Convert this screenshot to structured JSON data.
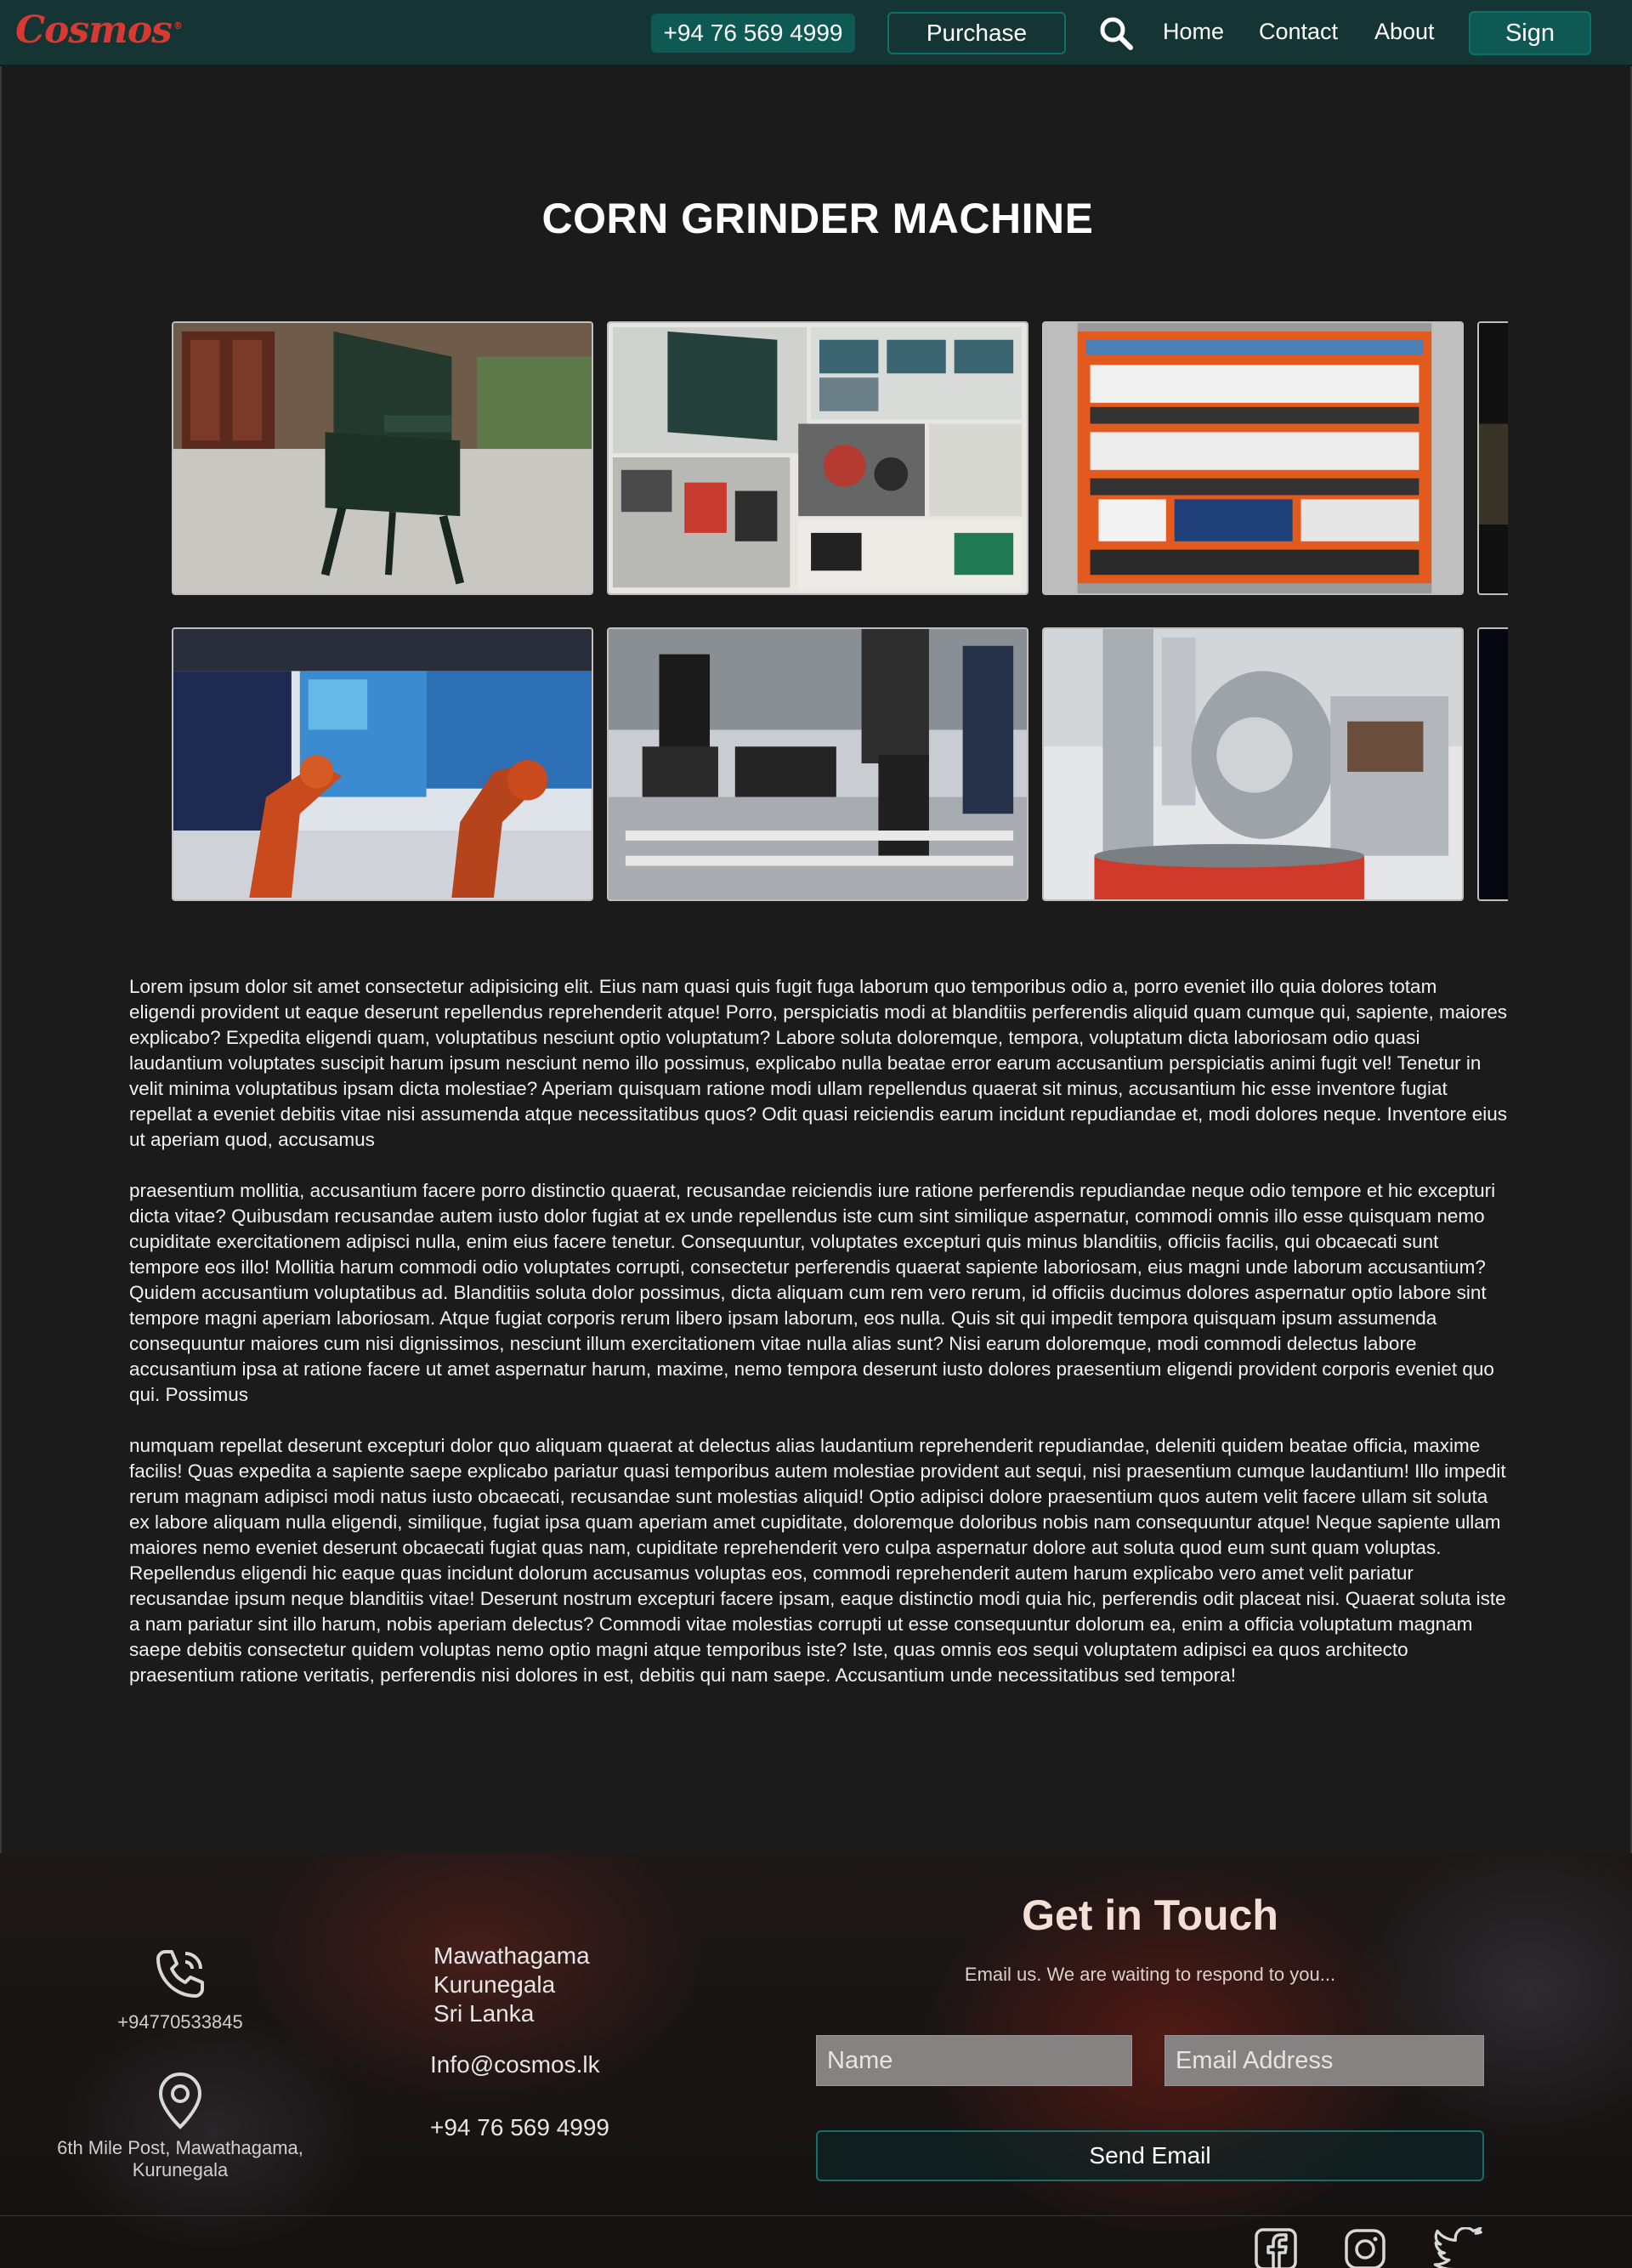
{
  "colors": {
    "page_bg": "#1b1b1b",
    "navbar_bg": "#143533",
    "accent_teal": "#0f5954",
    "logo_red": "#d83a33"
  },
  "navbar": {
    "logo": "Cosmos",
    "logo_mark": "®",
    "phone": "+94 76 569 4999",
    "purchase_label": "Purchase",
    "search_icon": "search-icon",
    "links": [
      "Home",
      "Contact",
      "About"
    ],
    "sign_label": "Sign"
  },
  "main": {
    "title": "CORN GRINDER MACHINE",
    "gallery": {
      "row1": [
        "corn-grinder-machine-photo",
        "machine-parts-collage-photo",
        "electrical-control-panel-photo",
        "partial-next-photo"
      ],
      "row2": [
        "orange-robot-arms-photo",
        "industrial-robotic-arms-photo",
        "coffee-roaster-machine-photo",
        "partial-next-photo"
      ]
    },
    "paragraphs": [
      "Lorem ipsum dolor sit amet consectetur adipisicing elit. Eius nam quasi quis fugit fuga laborum quo temporibus odio a, porro eveniet illo quia dolores totam eligendi provident ut eaque deserunt repellendus reprehenderit atque! Porro, perspiciatis modi at blanditiis perferendis aliquid quam cumque qui, sapiente, maiores explicabo? Expedita eligendi quam, voluptatibus nesciunt optio voluptatum? Labore soluta doloremque, tempora, voluptatum dicta laboriosam odio quasi laudantium voluptates suscipit harum ipsum nesciunt nemo illo possimus, explicabo nulla beatae error earum accusantium perspiciatis animi fugit vel! Tenetur in velit minima voluptatibus ipsam dicta molestiae? Aperiam quisquam ratione modi ullam repellendus quaerat sit minus, accusantium hic esse inventore fugiat repellat a eveniet debitis vitae nisi assumenda atque necessitatibus quos? Odit quasi reiciendis earum incidunt repudiandae et, modi dolores neque. Inventore eius ut aperiam quod, accusamus",
      "praesentium mollitia, accusantium facere porro distinctio quaerat, recusandae reiciendis iure ratione perferendis repudiandae neque odio tempore et hic excepturi dicta vitae? Quibusdam recusandae autem iusto dolor fugiat at ex unde repellendus iste cum sint similique aspernatur, commodi omnis illo esse quisquam nemo cupiditate exercitationem adipisci nulla, enim eius facere tenetur. Consequuntur, voluptates excepturi quis minus blanditiis, officiis facilis, qui obcaecati sunt tempore eos illo! Mollitia harum commodi odio voluptates corrupti, consectetur perferendis quaerat sapiente laboriosam, eius magni unde laborum accusantium? Quidem accusantium voluptatibus ad. Blanditiis soluta dolor possimus, dicta aliquam cum rem vero rerum, id officiis ducimus dolores aspernatur optio labore sint tempore magni aperiam laboriosam. Atque fugiat corporis rerum libero ipsam laborum, eos nulla. Quis sit qui impedit tempora quisquam ipsum assumenda consequuntur maiores cum nisi dignissimos, nesciunt illum exercitationem vitae nulla alias sunt? Nisi earum doloremque, modi commodi delectus labore accusantium ipsa at ratione facere ut amet aspernatur harum, maxime, nemo tempora deserunt iusto dolores praesentium eligendi provident corporis eveniet quo qui. Possimus",
      "numquam repellat deserunt excepturi dolor quo aliquam quaerat at delectus alias laudantium reprehenderit repudiandae, deleniti quidem beatae officia, maxime facilis! Quas expedita a sapiente saepe explicabo pariatur quasi temporibus autem molestiae provident aut sequi, nisi praesentium cumque laudantium! Illo impedit rerum magnam adipisci modi natus iusto obcaecati, recusandae sunt molestias aliquid! Optio adipisci dolore praesentium quos autem velit facere ullam sit soluta ex labore aliquam nulla eligendi, similique, fugiat ipsa quam aperiam amet cupiditate, doloremque doloribus nobis nam consequuntur atque! Neque sapiente ullam maiores nemo eveniet deserunt obcaecati fugiat quas nam, cupiditate reprehenderit vero culpa aspernatur dolore aut soluta quod eum sunt quam voluptas. Repellendus eligendi hic eaque quas incidunt dolorum accusamus voluptas eos, commodi reprehenderit autem harum explicabo vero amet velit pariatur recusandae ipsum neque blanditiis vitae! Deserunt nostrum excepturi facere ipsam, eaque distinctio modi quia hic, perferendis odit placeat nisi. Quaerat soluta iste a nam pariatur sint illo harum, nobis aperiam delectus? Commodi vitae molestias corrupti ut esse consequuntur dolorum ea, enim a officia voluptatum magnam saepe debitis consectetur quidem voluptas nemo optio magni atque temporibus iste? Iste, quas omnis eos sequi voluptatem adipisci ea quos architecto praesentium ratione veritatis, perferendis nisi dolores in est, debitis qui nam saepe. Accusantium unde necessitatibus sed tempora!"
    ]
  },
  "footer": {
    "phone_small": "+94770533845",
    "address_small": [
      "6th Mile Post, Mawathagama,",
      "Kurunegala"
    ],
    "address_lines": [
      "Mawathagama",
      "Kurunegala",
      "Sri Lanka"
    ],
    "email": "Info@cosmos.lk",
    "phone": "+94 76 569 4999",
    "touch_title": "Get in Touch",
    "touch_subtitle": "Email us. We are waiting to respond to you...",
    "name_placeholder": "Name",
    "email_placeholder": "Email Address",
    "send_label": "Send Email",
    "social_icons": [
      "facebook-icon",
      "instagram-icon",
      "twitter-icon"
    ]
  }
}
